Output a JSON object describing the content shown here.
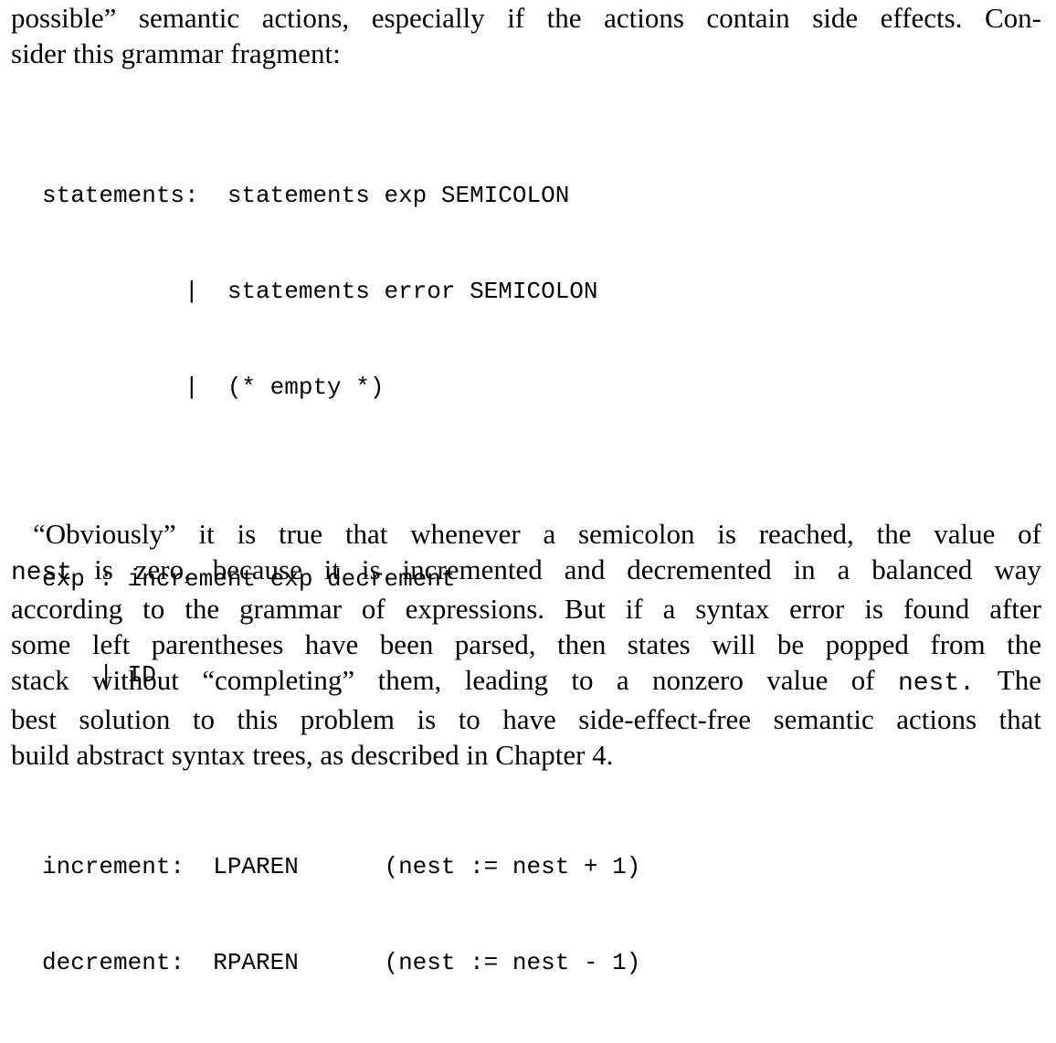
{
  "intro": {
    "lines": [
      "possible” semantic actions, especially if the actions contain side effects. Con-",
      "sider this grammar fragment:"
    ]
  },
  "code": {
    "lines": [
      "statements:  statements exp SEMICOLON",
      "          |  statements error SEMICOLON",
      "          |  (* empty *)",
      "",
      "exp : increment exp decrement",
      "    | ID",
      "",
      "increment:  LPAREN      (nest := nest + 1)",
      "decrement:  RPAREN      (nest := nest - 1)"
    ]
  },
  "body": {
    "line1": "“Obviously” it is true that whenever a semicolon is reached, the value of",
    "line2_code": "nest",
    "line2_rest": " is zero, because it is incremented and decremented in a balanced way",
    "line3": "according to the grammar of expressions. But if a syntax error is found after",
    "line4": "some left parentheses have been parsed, then states will be popped from the",
    "line5_pre": "stack without “completing” them, leading to a nonzero value of ",
    "line5_code": "nest.",
    "line5_post": " The",
    "line6": "best solution to this problem is to have side-effect-free semantic actions that",
    "line7": "build abstract syntax trees, as described in Chapter 4."
  }
}
